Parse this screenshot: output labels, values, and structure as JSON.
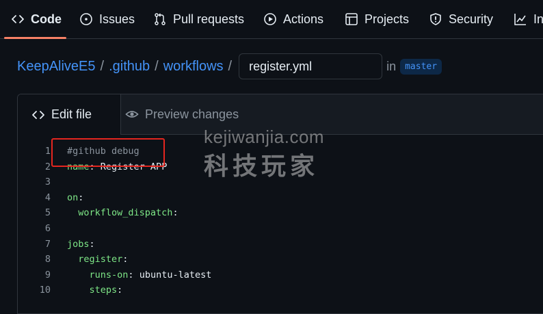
{
  "nav": {
    "tabs": [
      {
        "label": "Code",
        "icon": "code-icon",
        "active": true
      },
      {
        "label": "Issues",
        "icon": "issue-icon"
      },
      {
        "label": "Pull requests",
        "icon": "pull-request-icon"
      },
      {
        "label": "Actions",
        "icon": "play-icon"
      },
      {
        "label": "Projects",
        "icon": "table-icon"
      },
      {
        "label": "Security",
        "icon": "shield-icon"
      },
      {
        "label": "In",
        "icon": "graph-icon"
      }
    ],
    "accent_color": "#f78166"
  },
  "breadcrumb": {
    "owner": "KeepAliveE5",
    "dir1": ".github",
    "dir2": "workflows",
    "separator": "/",
    "filename": "register.yml",
    "in_label": "in",
    "branch": "master"
  },
  "editor": {
    "edit_tab": "Edit file",
    "preview_tab": "Preview changes",
    "lines": [
      {
        "n": "1",
        "indent": "",
        "key": "",
        "sep": "",
        "val": "",
        "comment": "#github debug"
      },
      {
        "n": "2",
        "indent": "",
        "key": "name",
        "sep": ":",
        "val": " Register APP",
        "comment": ""
      },
      {
        "n": "3",
        "indent": "",
        "key": "",
        "sep": "",
        "val": "",
        "comment": ""
      },
      {
        "n": "4",
        "indent": "",
        "key": "on",
        "sep": ":",
        "val": "",
        "comment": ""
      },
      {
        "n": "5",
        "indent": "  ",
        "key": "workflow_dispatch",
        "sep": ":",
        "val": "",
        "comment": ""
      },
      {
        "n": "6",
        "indent": "",
        "key": "",
        "sep": "",
        "val": "",
        "comment": ""
      },
      {
        "n": "7",
        "indent": "",
        "key": "jobs",
        "sep": ":",
        "val": "",
        "comment": ""
      },
      {
        "n": "8",
        "indent": "  ",
        "key": "register",
        "sep": ":",
        "val": "",
        "comment": ""
      },
      {
        "n": "9",
        "indent": "    ",
        "key": "runs-on",
        "sep": ":",
        "val": " ubuntu-latest",
        "comment": ""
      },
      {
        "n": "10",
        "indent": "    ",
        "key": "steps",
        "sep": ":",
        "val": "",
        "comment": ""
      }
    ]
  },
  "watermark": {
    "line1": "kejiwanjia.com",
    "line2": "科技玩家"
  },
  "highlight_color": "#e5261f"
}
